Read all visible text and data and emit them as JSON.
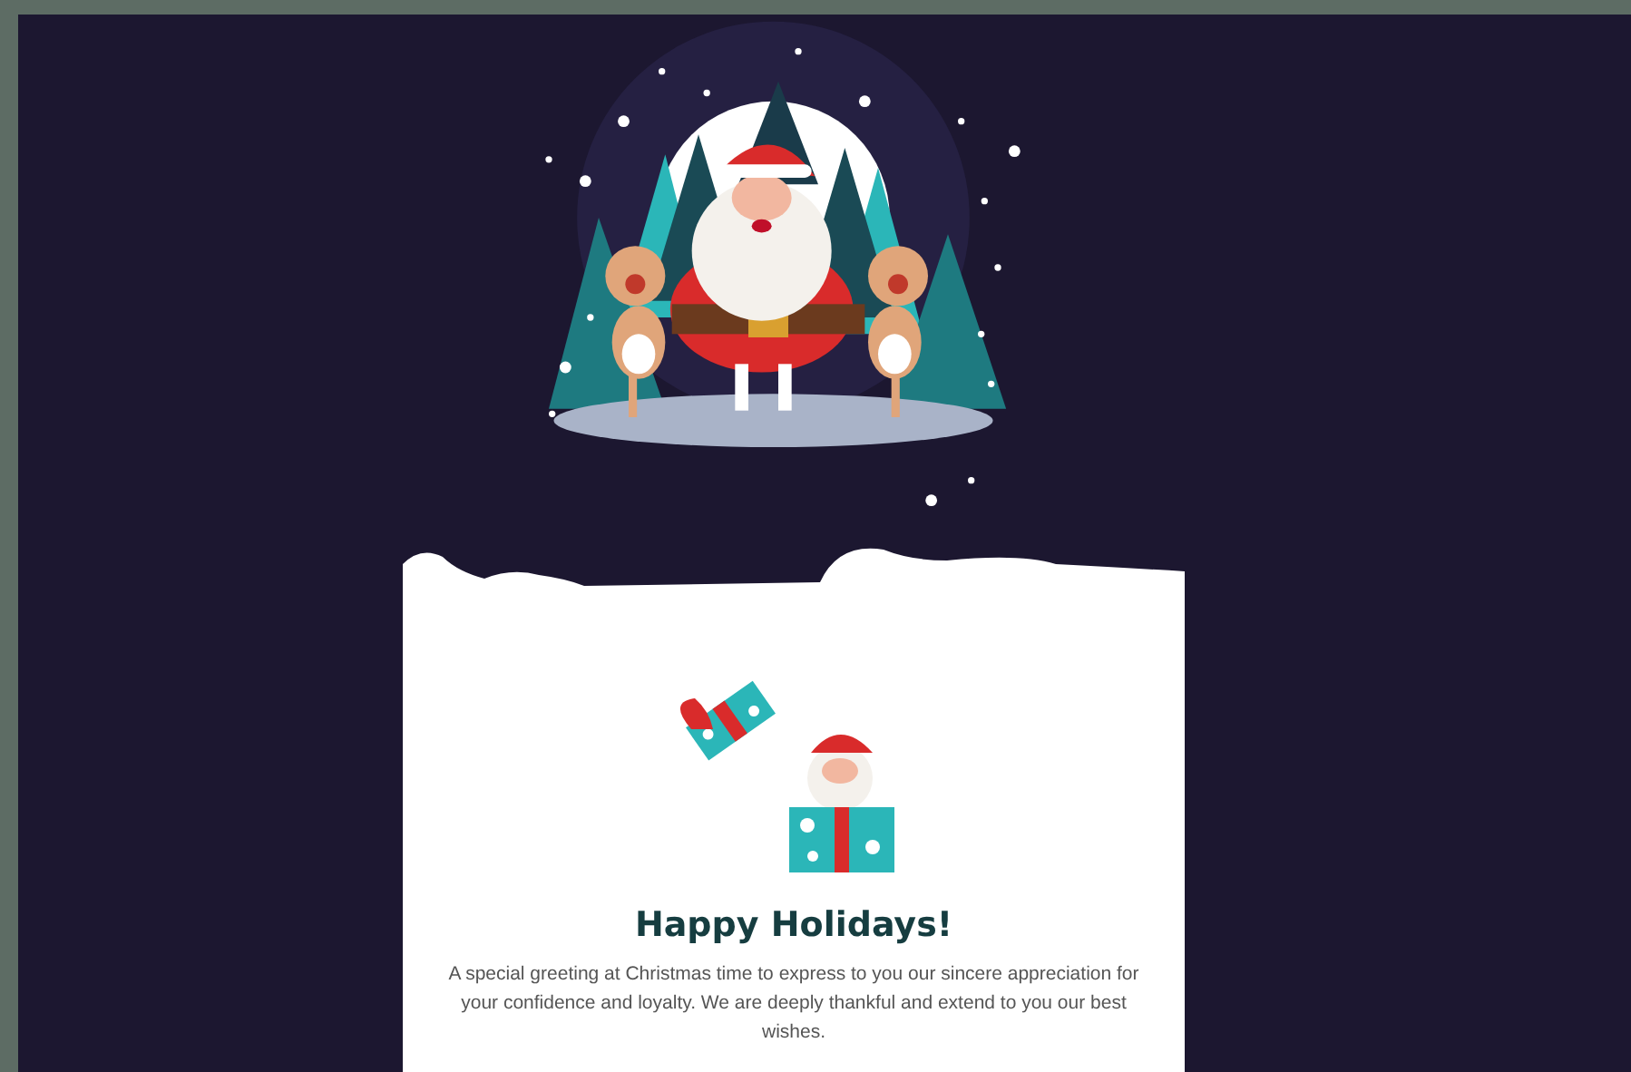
{
  "card": {
    "title": "Happy Holidays!",
    "message": "A special greeting at Christmas time to express to you our sincere appreciation for your confidence and loyalty. We are deeply thankful and extend to you our best wishes."
  }
}
